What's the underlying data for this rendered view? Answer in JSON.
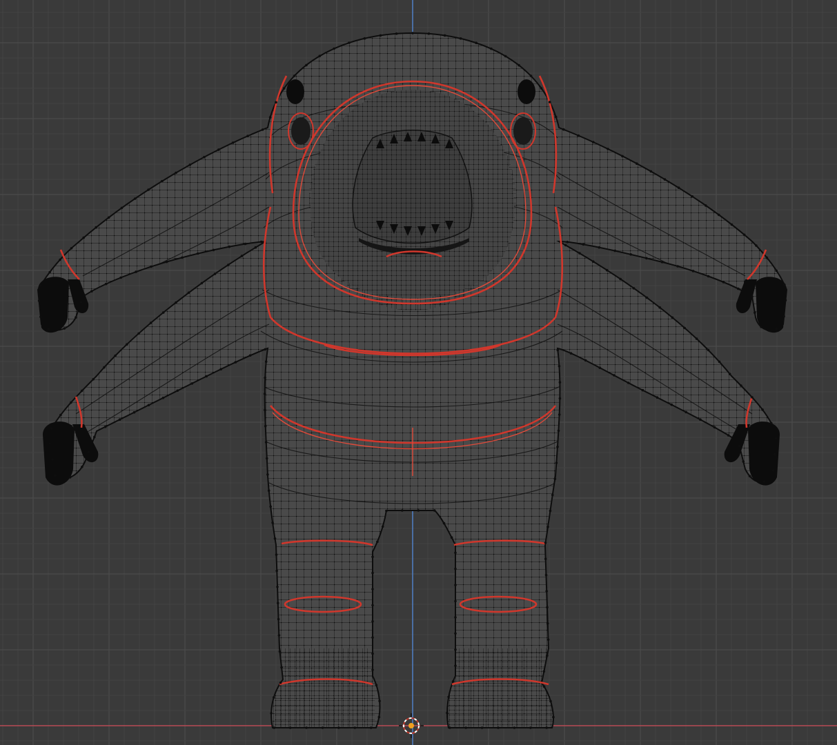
{
  "viewport": {
    "mode": "edit-mode-wireframe",
    "background_color": "#3a3a3a",
    "grid_color": "#464646",
    "mesh_color": "#4a4a4a",
    "wire_color": "#111111",
    "seam_color": "#d0372c",
    "axis_z_color": "#4f7cbe",
    "axis_x_color": "#b84a55"
  },
  "objects": [
    {
      "name": "creature-mesh",
      "selected": true,
      "seams_marked": true
    },
    {
      "name": "3d-cursor"
    }
  ]
}
